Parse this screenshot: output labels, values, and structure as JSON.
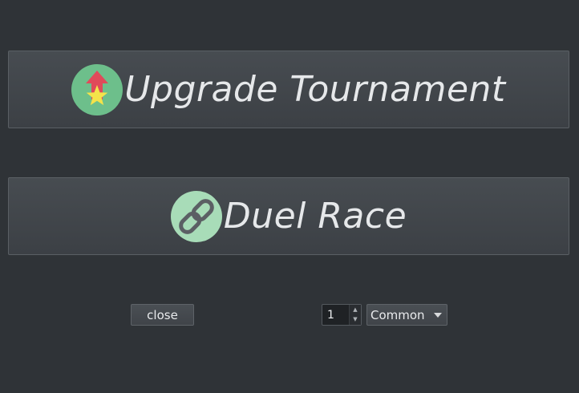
{
  "menu": {
    "upgrade_tournament": {
      "label": "Upgrade Tournament",
      "icon": "upgrade-arrow-star-icon"
    },
    "duel_race": {
      "label": "Duel Race",
      "icon": "chain-link-icon"
    }
  },
  "footer": {
    "close_label": "close",
    "quantity_value": "1",
    "rarity_selected": "Common"
  },
  "colors": {
    "background": "#2f3337",
    "button_face": "#43474c",
    "button_border": "#5a5f64",
    "label_text": "#e6e8ea",
    "upgrade_icon_circle": "#6dbf8b",
    "upgrade_arrow": "#e04a5a",
    "upgrade_star": "#f4e34a",
    "chain_icon_circle": "#a8dcb8",
    "chain_link": "#5b5f64"
  }
}
